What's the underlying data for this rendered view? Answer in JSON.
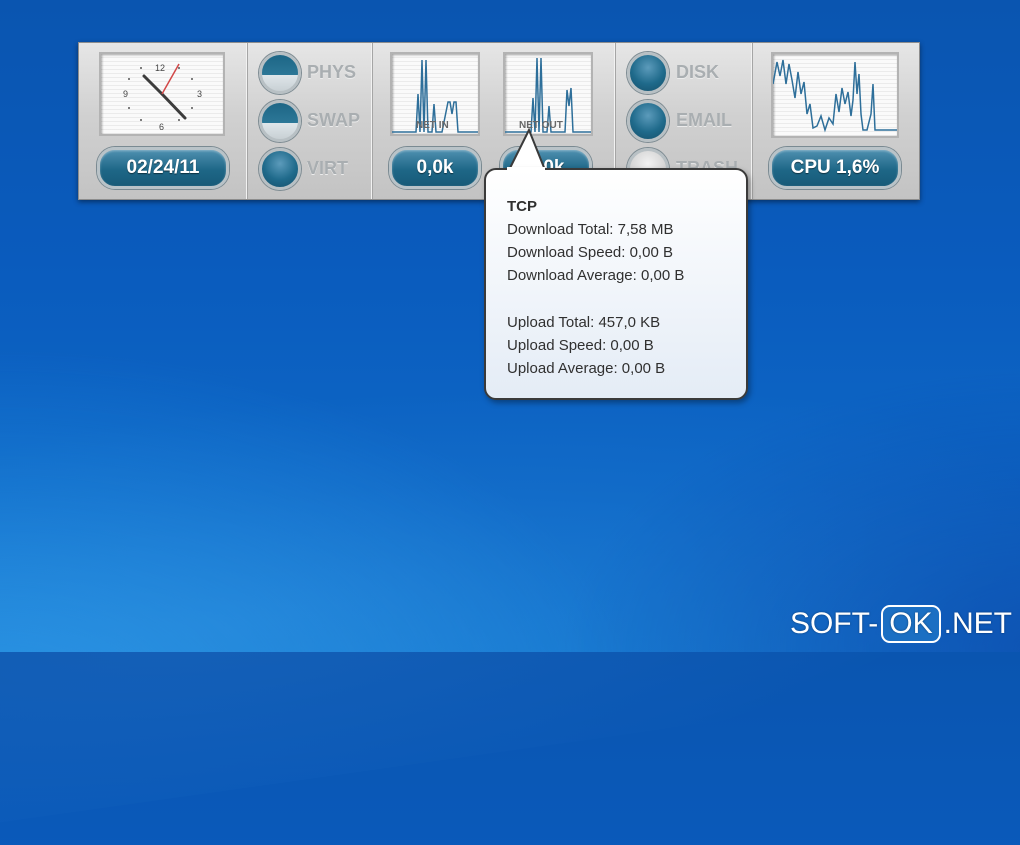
{
  "clock": {
    "date": "02/24/11",
    "numerals": [
      "12",
      "3",
      "6",
      "9"
    ]
  },
  "memory": {
    "items": [
      {
        "label": "PHYS",
        "state": "half"
      },
      {
        "label": "SWAP",
        "state": "half"
      },
      {
        "label": "VIRT",
        "state": "full"
      }
    ]
  },
  "network": {
    "net_in_label": "NET IN",
    "net_out_label": "NET OUT",
    "net_in_value": "0,0k",
    "net_out_value": "0,0k"
  },
  "status": {
    "items": [
      {
        "label": "DISK",
        "state": "on"
      },
      {
        "label": "EMAIL",
        "state": "on"
      },
      {
        "label": "TRASH",
        "state": "off"
      }
    ]
  },
  "cpu": {
    "label": "CPU 1,6%"
  },
  "tooltip": {
    "title": "TCP",
    "download_total": "Download Total: 7,58 MB",
    "download_speed": "Download Speed: 0,00 B",
    "download_average": "Download Average: 0,00 B",
    "upload_total": "Upload Total: 457,0 KB",
    "upload_speed": "Upload Speed: 0,00 B",
    "upload_average": "Upload Average: 0,00 B"
  },
  "watermark": {
    "left": "SOFT-",
    "box": "OK",
    "right": ".NET"
  },
  "colors": {
    "desktop": "#0b5dbd",
    "gadget_body": "#d4d4d4",
    "pill": "#1e6787",
    "graph_line": "#2e6f9a"
  }
}
